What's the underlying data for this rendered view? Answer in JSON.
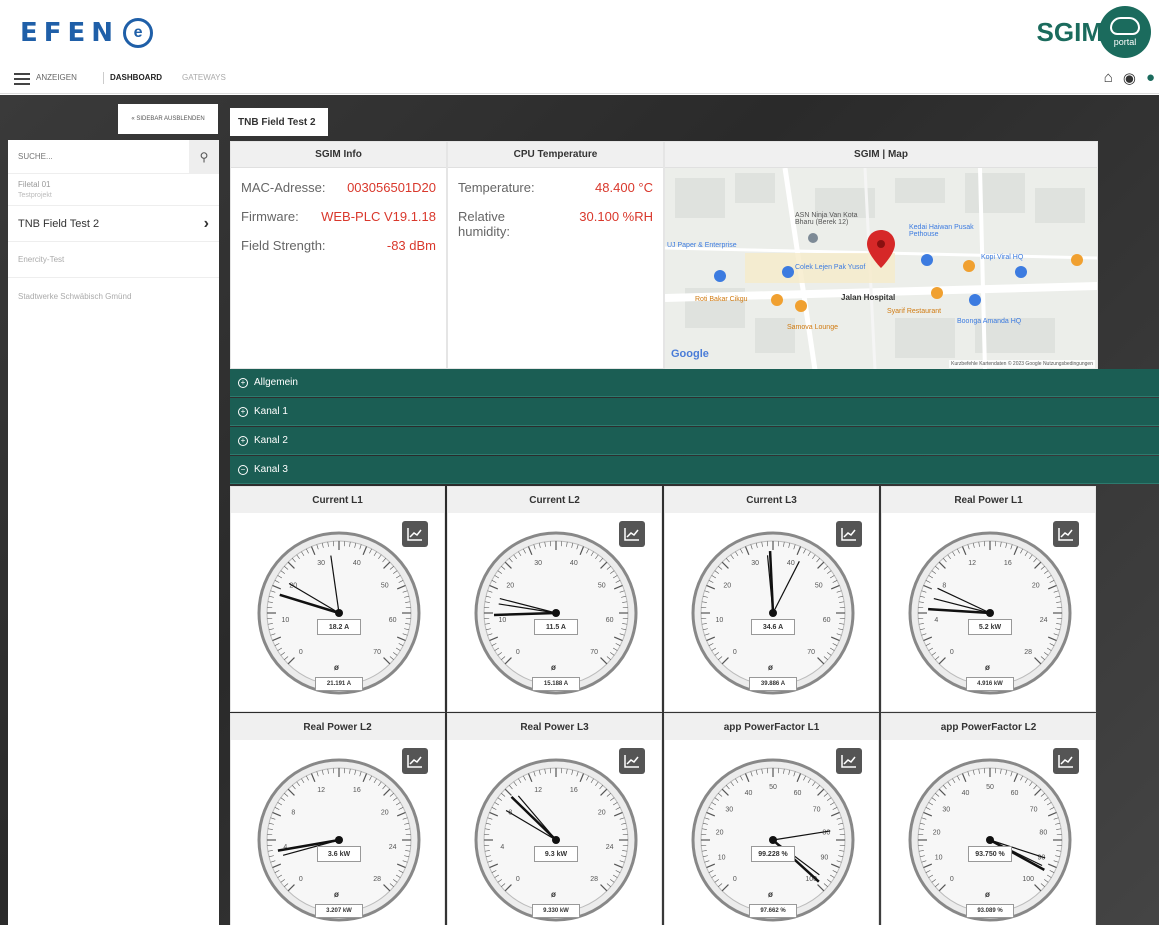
{
  "header": {
    "logo_text": "EFEN",
    "logo_mark": "e",
    "brand_text": "SGIM",
    "brand_sub": "portal"
  },
  "nav": {
    "show_label": "ANZEIGEN",
    "dashboard_label": "DASHBOARD",
    "gateways_label": "GATEWAYS",
    "icons": [
      "home-icon",
      "globe-icon",
      "user-icon"
    ]
  },
  "sidebar": {
    "hide_label": "« SIDEBAR AUSBLENDEN",
    "search_placeholder": "SUCHE...",
    "group_title": "Filetal 01",
    "group_sub": "Testprojekt",
    "items": [
      {
        "label": "TNB Field Test 2"
      },
      {
        "label": "Enercity-Test"
      },
      {
        "label": "Stadtwerke Schwäbisch Gmünd"
      }
    ]
  },
  "tab": {
    "label": "TNB Field Test 2"
  },
  "sgim_info": {
    "title": "SGIM Info",
    "rows": [
      {
        "label": "MAC-Adresse:",
        "value": "003056501D20"
      },
      {
        "label": "Firmware:",
        "value": "WEB-PLC V19.1.18"
      },
      {
        "label": "Field Strength:",
        "value": "-83 dBm"
      }
    ]
  },
  "cpu": {
    "title": "CPU Temperature",
    "temp_label": "Temperature:",
    "temp_value": "48.400 °C",
    "hum_label": "Relative humidity:",
    "hum_value": "30.100 %RH"
  },
  "map": {
    "title": "SGIM | Map",
    "labels": [
      "ASN Ninja Van Kota Bharu (Berek 12)",
      "Kedai Haiwan Pusak Pethouse",
      "UJ Paper & Enterprise",
      "Colek Lejen Pak Yusof",
      "Kopi Viral HQ",
      "Jalan Hospital",
      "Roti Bakar Cikgu",
      "Syarif Restaurant",
      "Boonga Amanda HQ",
      "Samova Lounge"
    ],
    "google": "Google",
    "footer": "Kurzbefehle   Kartendaten © 2023 Google   Nutzungsbedingungen"
  },
  "accordions": [
    {
      "label": "Allgemein"
    },
    {
      "label": "Kanal 1"
    },
    {
      "label": "Kanal 2"
    },
    {
      "label": "Kanal 3"
    }
  ],
  "gauges": [
    {
      "title": "Current L1",
      "value": "18.2 A",
      "avg": "21.191 A",
      "ticks": [
        "0",
        "10",
        "20",
        "30",
        "40",
        "50",
        "60",
        "70"
      ]
    },
    {
      "title": "Current L2",
      "value": "11.5 A",
      "avg": "15.188 A",
      "ticks": [
        "0",
        "10",
        "20",
        "30",
        "40",
        "50",
        "60",
        "70"
      ]
    },
    {
      "title": "Current L3",
      "value": "34.6 A",
      "avg": "39.886 A",
      "ticks": [
        "0",
        "10",
        "20",
        "30",
        "40",
        "50",
        "60",
        "70"
      ]
    },
    {
      "title": "Real Power L1",
      "value": "5.2 kW",
      "avg": "4.916 kW",
      "ticks": [
        "0",
        "4",
        "8",
        "12",
        "16",
        "20",
        "24",
        "28"
      ]
    },
    {
      "title": "Real Power L2",
      "value": "3.6 kW",
      "avg": "3.207 kW",
      "ticks": [
        "0",
        "4",
        "8",
        "12",
        "16",
        "20",
        "24",
        "28"
      ]
    },
    {
      "title": "Real Power L3",
      "value": "9.3 kW",
      "avg": "9.330 kW",
      "ticks": [
        "0",
        "4",
        "8",
        "12",
        "16",
        "20",
        "24",
        "28"
      ]
    },
    {
      "title": "app PowerFactor L1",
      "value": "99.228 %",
      "avg": "97.662 %",
      "ticks": [
        "0",
        "10",
        "20",
        "30",
        "40",
        "50",
        "60",
        "70",
        "80",
        "90",
        "100"
      ]
    },
    {
      "title": "app PowerFactor L2",
      "value": "93.750 %",
      "avg": "93.089 %",
      "ticks": [
        "0",
        "10",
        "20",
        "30",
        "40",
        "50",
        "60",
        "70",
        "80",
        "90",
        "100"
      ]
    }
  ],
  "gauge_levels": [
    {
      "needles": [
        0.23,
        0.47,
        0.28
      ]
    },
    {
      "needles": [
        0.16,
        0.2,
        0.22
      ]
    },
    {
      "needles": [
        0.49,
        0.6,
        0.48
      ]
    },
    {
      "needles": [
        0.18,
        0.22,
        0.26
      ]
    },
    {
      "needles": [
        0.13,
        0.13,
        0.11
      ]
    },
    {
      "needles": [
        0.33,
        0.35,
        0.28
      ]
    },
    {
      "needles": [
        0.99,
        0.97,
        0.8
      ]
    },
    {
      "needles": [
        0.94,
        0.93,
        0.9
      ]
    }
  ]
}
